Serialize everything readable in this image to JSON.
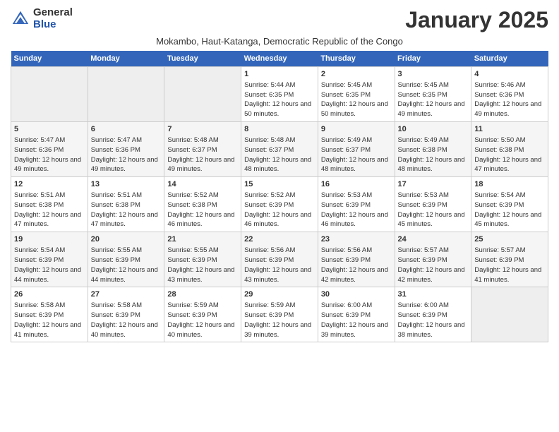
{
  "header": {
    "logo_general": "General",
    "logo_blue": "Blue",
    "month_title": "January 2025",
    "subtitle": "Mokambo, Haut-Katanga, Democratic Republic of the Congo"
  },
  "weekdays": [
    "Sunday",
    "Monday",
    "Tuesday",
    "Wednesday",
    "Thursday",
    "Friday",
    "Saturday"
  ],
  "weeks": [
    [
      {
        "day": "",
        "empty": true
      },
      {
        "day": "",
        "empty": true
      },
      {
        "day": "",
        "empty": true
      },
      {
        "day": "1",
        "rise": "5:44 AM",
        "set": "6:35 PM",
        "hours": "12 hours and 50 minutes."
      },
      {
        "day": "2",
        "rise": "5:45 AM",
        "set": "6:35 PM",
        "hours": "12 hours and 50 minutes."
      },
      {
        "day": "3",
        "rise": "5:45 AM",
        "set": "6:35 PM",
        "hours": "12 hours and 49 minutes."
      },
      {
        "day": "4",
        "rise": "5:46 AM",
        "set": "6:36 PM",
        "hours": "12 hours and 49 minutes."
      }
    ],
    [
      {
        "day": "5",
        "rise": "5:47 AM",
        "set": "6:36 PM",
        "hours": "12 hours and 49 minutes."
      },
      {
        "day": "6",
        "rise": "5:47 AM",
        "set": "6:36 PM",
        "hours": "12 hours and 49 minutes."
      },
      {
        "day": "7",
        "rise": "5:48 AM",
        "set": "6:37 PM",
        "hours": "12 hours and 49 minutes."
      },
      {
        "day": "8",
        "rise": "5:48 AM",
        "set": "6:37 PM",
        "hours": "12 hours and 48 minutes."
      },
      {
        "day": "9",
        "rise": "5:49 AM",
        "set": "6:37 PM",
        "hours": "12 hours and 48 minutes."
      },
      {
        "day": "10",
        "rise": "5:49 AM",
        "set": "6:38 PM",
        "hours": "12 hours and 48 minutes."
      },
      {
        "day": "11",
        "rise": "5:50 AM",
        "set": "6:38 PM",
        "hours": "12 hours and 47 minutes."
      }
    ],
    [
      {
        "day": "12",
        "rise": "5:51 AM",
        "set": "6:38 PM",
        "hours": "12 hours and 47 minutes."
      },
      {
        "day": "13",
        "rise": "5:51 AM",
        "set": "6:38 PM",
        "hours": "12 hours and 47 minutes."
      },
      {
        "day": "14",
        "rise": "5:52 AM",
        "set": "6:38 PM",
        "hours": "12 hours and 46 minutes."
      },
      {
        "day": "15",
        "rise": "5:52 AM",
        "set": "6:39 PM",
        "hours": "12 hours and 46 minutes."
      },
      {
        "day": "16",
        "rise": "5:53 AM",
        "set": "6:39 PM",
        "hours": "12 hours and 46 minutes."
      },
      {
        "day": "17",
        "rise": "5:53 AM",
        "set": "6:39 PM",
        "hours": "12 hours and 45 minutes."
      },
      {
        "day": "18",
        "rise": "5:54 AM",
        "set": "6:39 PM",
        "hours": "12 hours and 45 minutes."
      }
    ],
    [
      {
        "day": "19",
        "rise": "5:54 AM",
        "set": "6:39 PM",
        "hours": "12 hours and 44 minutes."
      },
      {
        "day": "20",
        "rise": "5:55 AM",
        "set": "6:39 PM",
        "hours": "12 hours and 44 minutes."
      },
      {
        "day": "21",
        "rise": "5:55 AM",
        "set": "6:39 PM",
        "hours": "12 hours and 43 minutes."
      },
      {
        "day": "22",
        "rise": "5:56 AM",
        "set": "6:39 PM",
        "hours": "12 hours and 43 minutes."
      },
      {
        "day": "23",
        "rise": "5:56 AM",
        "set": "6:39 PM",
        "hours": "12 hours and 42 minutes."
      },
      {
        "day": "24",
        "rise": "5:57 AM",
        "set": "6:39 PM",
        "hours": "12 hours and 42 minutes."
      },
      {
        "day": "25",
        "rise": "5:57 AM",
        "set": "6:39 PM",
        "hours": "12 hours and 41 minutes."
      }
    ],
    [
      {
        "day": "26",
        "rise": "5:58 AM",
        "set": "6:39 PM",
        "hours": "12 hours and 41 minutes."
      },
      {
        "day": "27",
        "rise": "5:58 AM",
        "set": "6:39 PM",
        "hours": "12 hours and 40 minutes."
      },
      {
        "day": "28",
        "rise": "5:59 AM",
        "set": "6:39 PM",
        "hours": "12 hours and 40 minutes."
      },
      {
        "day": "29",
        "rise": "5:59 AM",
        "set": "6:39 PM",
        "hours": "12 hours and 39 minutes."
      },
      {
        "day": "30",
        "rise": "6:00 AM",
        "set": "6:39 PM",
        "hours": "12 hours and 39 minutes."
      },
      {
        "day": "31",
        "rise": "6:00 AM",
        "set": "6:39 PM",
        "hours": "12 hours and 38 minutes."
      },
      {
        "day": "",
        "empty": true
      }
    ]
  ],
  "labels": {
    "sunrise": "Sunrise:",
    "sunset": "Sunset:",
    "daylight": "Daylight:"
  }
}
